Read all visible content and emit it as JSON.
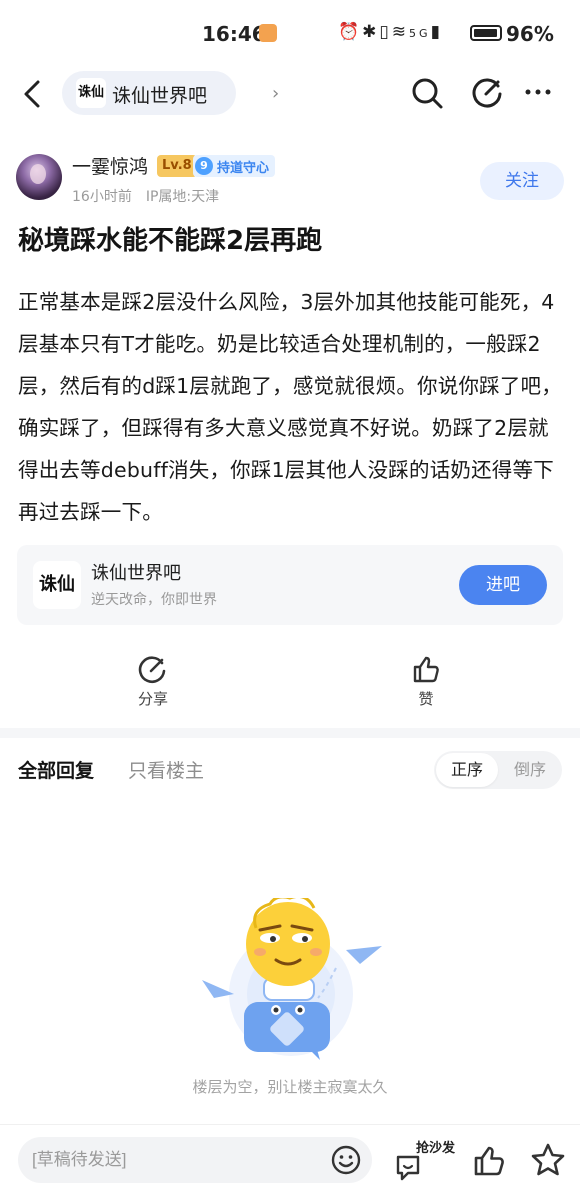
{
  "status_bar": {
    "time": "16:46",
    "signal_label": "5G",
    "battery": "96%"
  },
  "nav": {
    "forum_name": "诛仙世界吧",
    "forum_logo_text": "诛仙"
  },
  "post": {
    "author": "一霎惊鸿",
    "level": "Lv.8",
    "guard_level": "9",
    "guard_label": "持道守心",
    "time_ago": "16小时前",
    "ip_location": "IP属地:天津",
    "follow_label": "关注",
    "title": "秘境踩水能不能踩2层再跑",
    "body": "正常基本是踩2层没什么风险，3层外加其他技能可能死，4层基本只有T才能吃。奶是比较适合处理机制的，一般踩2层，然后有的d踩1层就跑了，感觉就很烦。你说你踩了吧，确实踩了，但踩得有多大意义感觉真不好说。奶踩了2层就得出去等debuff消失，你踩1层其他人没踩的话奶还得等下再过去踩一下。"
  },
  "forum_card": {
    "logo_text": "诛仙",
    "name": "诛仙世界吧",
    "slogan": "逆天改命，你即世界",
    "enter_label": "进吧"
  },
  "actions": {
    "share_label": "分享",
    "like_label": "赞"
  },
  "replies": {
    "tab_all": "全部回复",
    "tab_op_only": "只看楼主",
    "order_asc": "正序",
    "order_desc": "倒序",
    "empty_text": "楼层为空，别让楼主寂寞太久"
  },
  "bottom_bar": {
    "draft_placeholder": "[草稿待发送]",
    "sofa_label": "抢沙发"
  },
  "colors": {
    "accent": "#4b84f0",
    "follow_bg": "#eaf1ff",
    "level_bg": "#f6c760",
    "guard_bg": "#e6f1ff"
  }
}
